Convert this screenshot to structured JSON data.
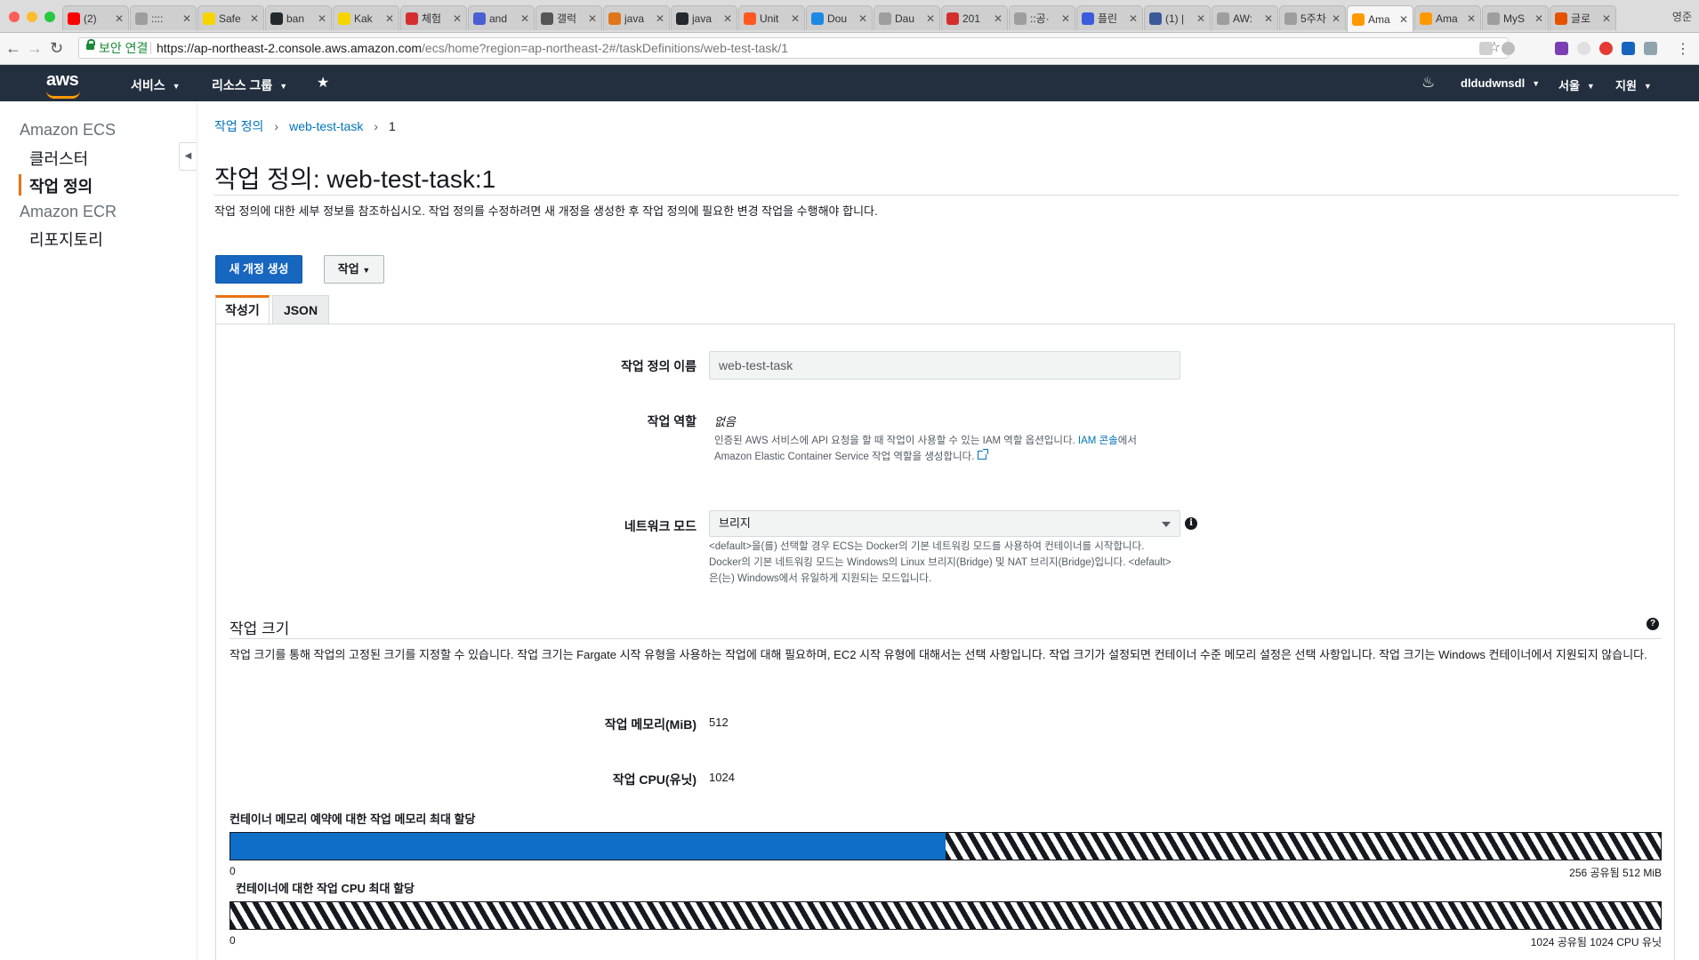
{
  "browser": {
    "tabs": [
      {
        "title": "(2)",
        "color": "#ff0000"
      },
      {
        "title": "::::",
        "color": "#9e9e9e"
      },
      {
        "title": "Safe",
        "color": "#f7d400"
      },
      {
        "title": "ban",
        "color": "#24292e"
      },
      {
        "title": "Kak",
        "color": "#f7d400"
      },
      {
        "title": "체험",
        "color": "#d32f2f"
      },
      {
        "title": "and",
        "color": "#4a5fd1"
      },
      {
        "title": "갤럭",
        "color": "#555555"
      },
      {
        "title": "java",
        "color": "#e0751a"
      },
      {
        "title": "java",
        "color": "#24292e"
      },
      {
        "title": "Unit",
        "color": "#ff5722"
      },
      {
        "title": "Dou",
        "color": "#1e88e5"
      },
      {
        "title": "Dau",
        "color": "#9e9e9e"
      },
      {
        "title": "201",
        "color": "#d32f2f"
      },
      {
        "title": "::공·",
        "color": "#9e9e9e"
      },
      {
        "title": "플린",
        "color": "#3b5bdb"
      },
      {
        "title": "(1) |",
        "color": "#3b5998"
      },
      {
        "title": "AW:",
        "color": "#9e9e9e"
      },
      {
        "title": "5주차",
        "color": "#9e9e9e"
      },
      {
        "title": "Ama",
        "color": "#ff9900",
        "active": true
      },
      {
        "title": "Ama",
        "color": "#ff9900"
      },
      {
        "title": "MyS",
        "color": "#9e9e9e"
      },
      {
        "title": "글로",
        "color": "#e65100"
      }
    ],
    "profile": "영준",
    "secure_label": "보안 연결",
    "url_host": "https://ap-northeast-2.console.aws.amazon.com",
    "url_rest": "/ecs/home?region=ap-northeast-2#/taskDefinitions/web-test-task/1"
  },
  "aws_header": {
    "logo": "aws",
    "services": "서비스",
    "resource_groups": "리소스 그룹",
    "username": "dldudwnsdl",
    "region": "서울",
    "support": "지원"
  },
  "sidebar": {
    "ecs_section": "Amazon ECS",
    "ecs_items": [
      "클러스터",
      "작업 정의"
    ],
    "ecr_section": "Amazon ECR",
    "ecr_items": [
      "리포지토리"
    ]
  },
  "breadcrumb": {
    "root": "작업 정의",
    "family": "web-test-task",
    "revision": "1"
  },
  "page": {
    "title": "작업 정의: web-test-task:1",
    "description": "작업 정의에 대한 세부 정보를 참조하십시오. 작업 정의를 수정하려면 새 개정을 생성한 후 작업 정의에 필요한 변경 작업을 수행해야 합니다.",
    "create_revision_button": "새 개정 생성",
    "actions_button": "작업"
  },
  "tabs": {
    "builder": "작성기",
    "json": "JSON"
  },
  "form": {
    "name_label": "작업 정의 이름",
    "name_value": "web-test-task",
    "role_label": "작업 역할",
    "role_value": "없음",
    "role_help_1": "인증된 AWS 서비스에 API 요청을 할 때 작업이 사용할 수 있는 IAM 역할 옵션입니다.",
    "role_help_link": "IAM 콘솔",
    "role_help_2": "에서",
    "role_help_3": "Amazon Elastic Container Service 작업 역할을 생성합니다.",
    "network_label": "네트워크 모드",
    "network_value": "브리지",
    "network_help_1": "<default>을(를) 선택할 경우 ECS는 Docker의 기본 네트워킹 모드를 사용하여 컨테이너를 시작합니다.",
    "network_help_2": "Docker의 기본 네트워킹 모드는 Windows의 Linux 브리지(Bridge) 및 NAT 브리지(Bridge)입니다. <default>",
    "network_help_3": "은(는) Windows에서 유일하게 지원되는 모드입니다."
  },
  "task_size": {
    "title": "작업 크기",
    "description": "작업 크기를 통해 작업의 고정된 크기를 지정할 수 있습니다. 작업 크기는 Fargate 시작 유형을 사용하는 작업에 대해 필요하며, EC2 시작 유형에 대해서는 선택 사항입니다. 작업 크기가 설정되면 컨테이너 수준 메모리 설정은 선택 사항입니다. 작업 크기는 Windows 컨테이너에서 지원되지 않습니다.",
    "memory_label": "작업 메모리(MiB)",
    "memory_value": "512",
    "cpu_label": "작업 CPU(유닛)",
    "cpu_value": "1024",
    "memory_bar": {
      "title": "컨테이너 메모리 예약에 대한 작업 메모리 최대 할당",
      "min_label": "0",
      "max_label": "256 공유됨 512 MiB",
      "reserved_fraction": 0.5,
      "fill_color": "#0f6fc6"
    },
    "cpu_bar": {
      "title": "컨테이너에 대한 작업 CPU 최대 할당",
      "min_label": "0",
      "max_label": "1024 공유됨 1024 CPU 유닛",
      "reserved_fraction": 0
    }
  }
}
